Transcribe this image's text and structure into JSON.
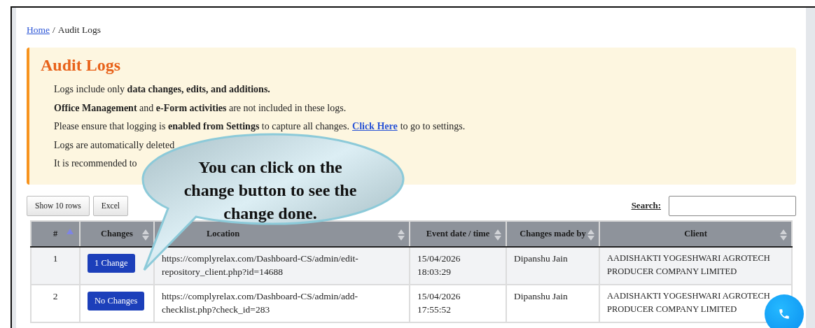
{
  "breadcrumb": {
    "link": "Home",
    "separator": "/",
    "current": "Audit Logs"
  },
  "notice": {
    "title": "Audit Logs",
    "lines": [
      {
        "parts": [
          "Logs include only **data changes, edits, and additions.**"
        ]
      },
      {
        "parts": [
          "**Office Management** and **e-Form activities** are not included in these logs."
        ]
      },
      {
        "parts": [
          "Please ensure that logging is **enabled from Settings** to capture all changes."
        ],
        "link": "Click Here",
        "after": "to go to settings."
      },
      {
        "parts": [
          "Logs are automatically deleted"
        ]
      },
      {
        "parts": [
          "It is recommended to"
        ]
      }
    ]
  },
  "toolbar": {
    "buttons": [
      "Show 10 rows",
      "Excel"
    ],
    "search_label": "Search:"
  },
  "table": {
    "columns": [
      {
        "label": "#",
        "sorted": true
      },
      {
        "label": "Changes",
        "sorted": false
      },
      {
        "label": "Location",
        "sorted": false
      },
      {
        "label": "Event date / time",
        "sorted": false
      },
      {
        "label": "Changes made by",
        "sorted": false
      },
      {
        "label": "Client",
        "sorted": false
      }
    ],
    "rows": [
      {
        "index": "1",
        "changes": "1 Change",
        "location": "https://complyrelax.com/Dashboard-CS/admin/edit-repository_client.php?id=14688",
        "date": "15/04/2026",
        "time": "18:03:29",
        "user": "Dipanshu Jain",
        "client": "AADISHAKTI YOGESHWARI AGROTECH PRODUCER COMPANY LIMITED"
      },
      {
        "index": "2",
        "changes": "No Changes",
        "location": "https://complyrelax.com/Dashboard-CS/admin/add-checklist.php?check_id=283",
        "date": "15/04/2026",
        "time": "17:55:52",
        "user": "Dipanshu Jain",
        "client": "AADISHAKTI YOGESHWARI AGROTECH PRODUCER COMPANY LIMITED"
      }
    ]
  },
  "callout": {
    "text": "You can click on the change button to see the change done."
  }
}
